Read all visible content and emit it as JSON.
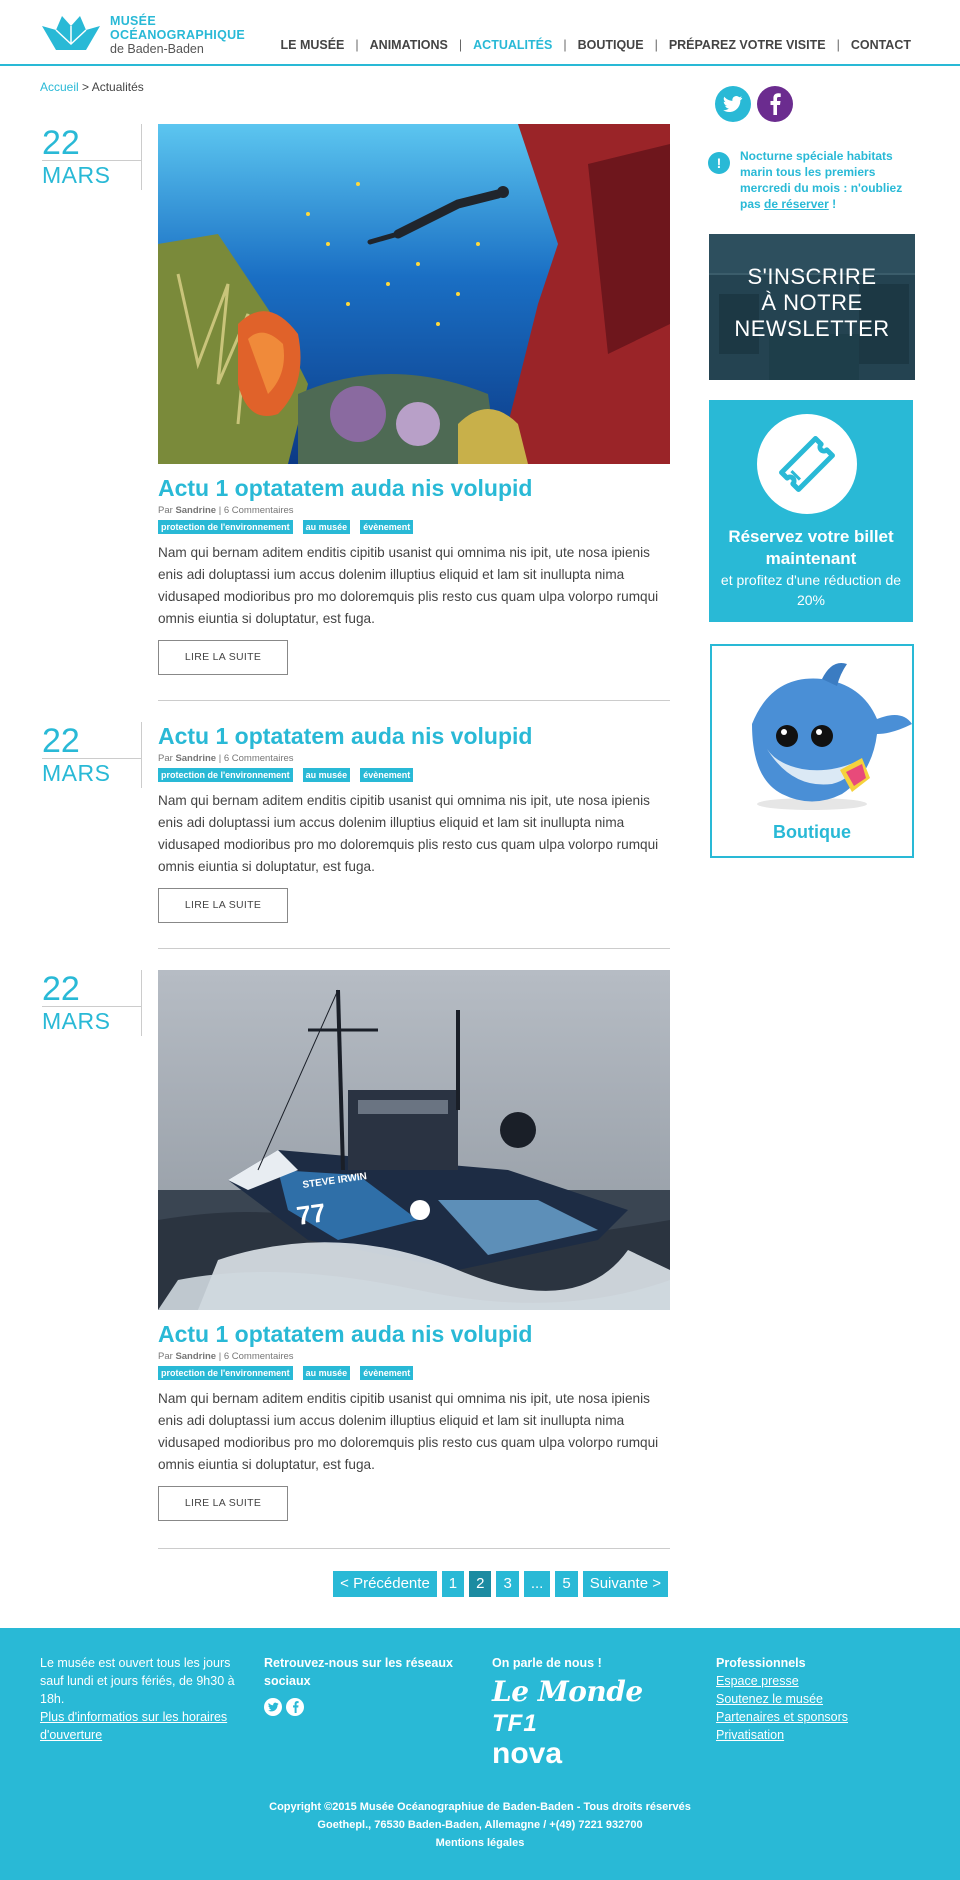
{
  "header": {
    "logo": {
      "line1": "MUSÉE",
      "line2": "OCÉANOGRAPHIQUE",
      "line3": "de Baden-Baden"
    },
    "nav": [
      {
        "label": "LE MUSÉE",
        "active": false
      },
      {
        "label": "ANIMATIONS",
        "active": false
      },
      {
        "label": "ACTUALITÉS",
        "active": true
      },
      {
        "label": "BOUTIQUE",
        "active": false
      },
      {
        "label": "PRÉPAREZ VOTRE VISITE",
        "active": false
      },
      {
        "label": "CONTACT",
        "active": false
      }
    ],
    "nav_separator": "|"
  },
  "breadcrumb": {
    "home": "Accueil",
    "separator": ">",
    "current": "Actualités"
  },
  "articles": [
    {
      "day": "22",
      "month": "MARS",
      "image": "coral-reef-diver-photo",
      "title": "Actu 1 optatatem auda nis volupid",
      "author_prefix": "Par",
      "author": "Sandrine",
      "comments": "6 Commentaires",
      "tags": [
        "protection de l'environnement",
        "au musée",
        "évènement"
      ],
      "text": "Nam qui bernam aditem enditis cipitib usanist qui omnima nis ipit, ute nosa ipienis enis adi doluptassi ium accus dolenim illuptius eliquid et lam sit inullupta nima vidusaped modioribus pro mo doloremquis plis resto cus quam ulpa volorpo rumqui omnis eiuntia si doluptatur, est fuga.",
      "button": "LIRE LA SUITE"
    },
    {
      "day": "22",
      "month": "MARS",
      "image": "",
      "title": "Actu 1 optatatem auda nis volupid",
      "author_prefix": "Par",
      "author": "Sandrine",
      "comments": "6 Commentaires",
      "tags": [
        "protection de l'environnement",
        "au musée",
        "évènement"
      ],
      "text": "Nam qui bernam aditem enditis cipitib usanist qui omnima nis ipit, ute nosa ipienis enis adi doluptassi ium accus dolenim illuptius eliquid et lam sit inullupta nima vidusaped modioribus pro mo doloremquis plis resto cus quam ulpa volorpo rumqui omnis eiuntia si doluptatur, est fuga.",
      "button": "LIRE LA SUITE"
    },
    {
      "day": "22",
      "month": "MARS",
      "image": "sea-shepherd-ship-photo",
      "ship_name": "STEVE IRWIN",
      "ship_number": "77",
      "title": "Actu 1 optatatem auda nis volupid",
      "author_prefix": "Par",
      "author": "Sandrine",
      "comments": "6 Commentaires",
      "tags": [
        "protection de l'environnement",
        "au musée",
        "évènement"
      ],
      "text": "Nam qui bernam aditem enditis cipitib usanist qui omnima nis ipit, ute nosa ipienis enis adi doluptassi ium accus dolenim illuptius eliquid et lam sit inullupta nima vidusaped modioribus pro mo doloremquis plis resto cus quam ulpa volorpo rumqui omnis eiuntia si doluptatur, est fuga.",
      "button": "LIRE LA SUITE"
    }
  ],
  "pagination": {
    "prev": "< Précédente",
    "pages": [
      "1",
      "2",
      "3",
      "...",
      "5"
    ],
    "current": "2",
    "next": "Suivante >"
  },
  "sidebar": {
    "social": [
      "twitter-icon",
      "facebook-icon"
    ],
    "notice": {
      "text": "Nocturne spéciale habitats marin tous les premiers mercredi du mois : n'oubliez pas",
      "link": "de réserver",
      "suffix": " !"
    },
    "newsletter": {
      "line1": "S'INSCRIRE",
      "line2": "À NOTRE",
      "line3": "NEWSLETTER"
    },
    "ticket": {
      "title": "Réservez votre billet maintenant",
      "subtitle": "et profitez d'une réduction de 20%"
    },
    "shop": {
      "label": "Boutique"
    }
  },
  "footer": {
    "hours": {
      "text": "Le musée est ouvert tous les jours sauf lundi et jours fériés, de 9h30 à 18h.",
      "link": "Plus d'informatios sur les horaires d'ouverture"
    },
    "social": {
      "heading": "Retrouvez-nous sur les réseaux sociaux"
    },
    "press": {
      "heading": "On parle de nous !",
      "logos": [
        "Le Monde",
        "TF1",
        "nova"
      ]
    },
    "pro": {
      "heading": "Professionnels",
      "links": [
        "Espace presse",
        "Soutenez le musée",
        "Partenaires et sponsors",
        "Privatisation"
      ]
    },
    "copyright": "Copyright ©2015 Musée Océanographiue de Baden-Baden - Tous droits réservés",
    "address": "Goethepl., 76530 Baden-Baden, Allemagne / +(49) 7221 932700",
    "legal": "Mentions légales"
  },
  "colors": {
    "accent": "#29b9d6",
    "accent_dark": "#1c8ba1",
    "facebook": "#6b2c8f"
  }
}
